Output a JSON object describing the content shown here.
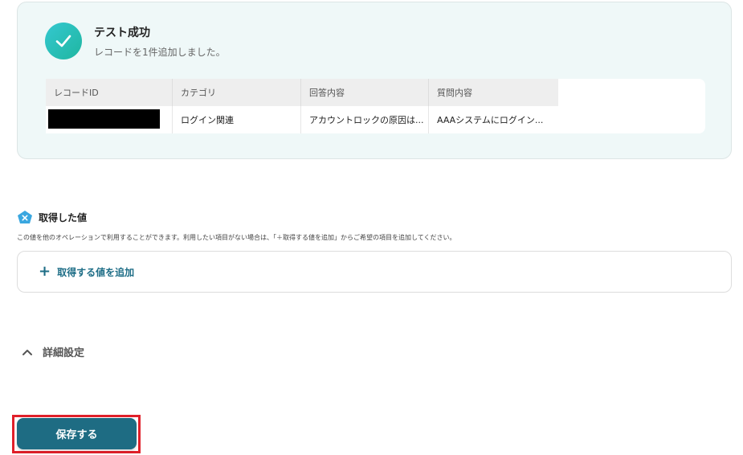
{
  "success": {
    "title": "テスト成功",
    "subtitle": "レコードを1件追加しました。",
    "icon": "check-icon"
  },
  "table": {
    "headers": [
      "レコードID",
      "カテゴリ",
      "回答内容",
      "質問内容"
    ],
    "rows": [
      [
        "",
        "ログイン関連",
        "アカウントロックの原因は...",
        "AAAシステムにログイン..."
      ]
    ]
  },
  "fetched": {
    "title": "取得した値",
    "description": "この値を他のオペレーションで利用することができます。利用したい項目がない場合は、「＋取得する値を追加」からご希望の項目を追加してください。",
    "add_label": "取得する値を追加",
    "add_icon": "plus-icon",
    "section_icon": "pentagon-x-icon"
  },
  "details": {
    "label": "詳細設定",
    "icon": "chevron-up-icon"
  },
  "save": {
    "label": "保存する"
  },
  "colors": {
    "accent": "#1e6c83",
    "success_start": "#34c8d0",
    "success_end": "#1fb6a0",
    "highlight": "#e0202a"
  }
}
